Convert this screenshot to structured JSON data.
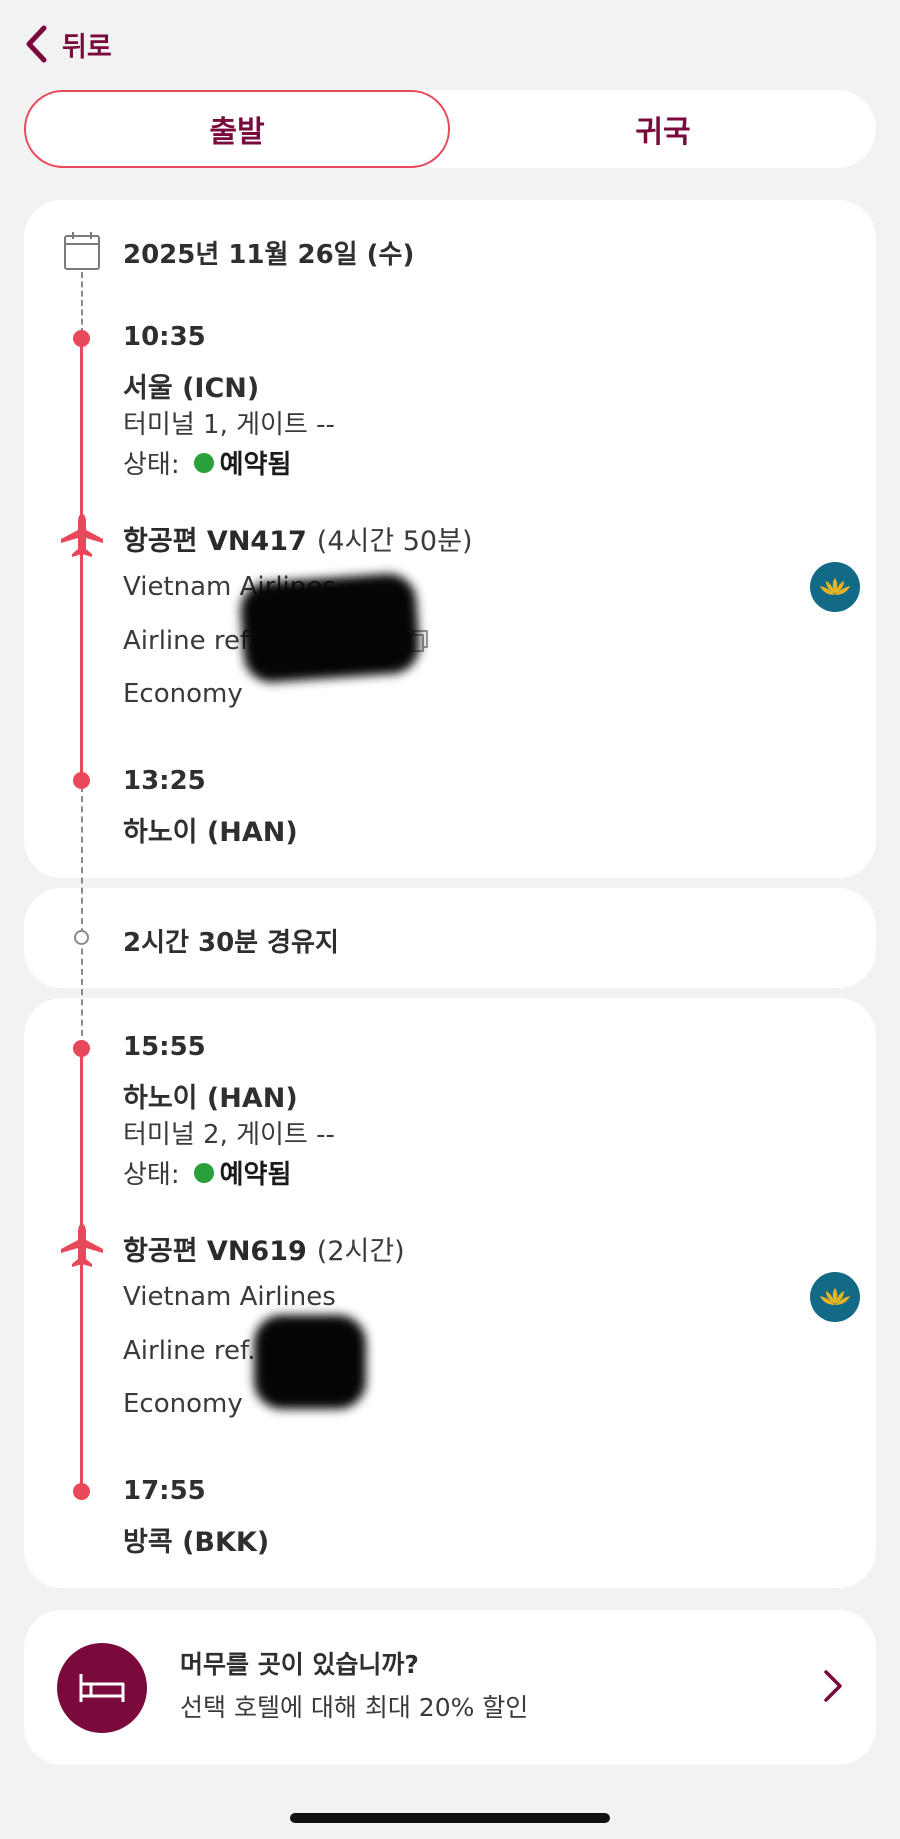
{
  "nav": {
    "back_label": "뒤로"
  },
  "tabs": {
    "departure": "출발",
    "return": "귀국"
  },
  "segment1": {
    "date": "2025년 11월 26일 (수)",
    "dep_time": "10:35",
    "dep_city": "서울 (ICN)",
    "dep_terminal": "터미널 1,  게이트 --",
    "status_label": "상태:",
    "status_value": "예약됨",
    "flight_label": "항공편 VN417",
    "flight_duration": "(4시간 50분)",
    "airline": "Vietnam Airlines",
    "airline_ref": "Airline ref. 80",
    "cabin": "Economy",
    "arr_time": "13:25",
    "arr_city": "하노이 (HAN)"
  },
  "layover": {
    "text": "2시간 30분 경유지"
  },
  "segment2": {
    "dep_time": "15:55",
    "dep_city": "하노이 (HAN)",
    "dep_terminal": "터미널 2,  게이트 --",
    "status_label": "상태:",
    "status_value": "예약됨",
    "flight_label": "항공편 VN619",
    "flight_duration": "(2시간)",
    "airline": "Vietnam Airlines",
    "airline_ref": "Airline ref.      BIR",
    "cabin": "Economy",
    "arr_time": "17:55",
    "arr_city": "방콕 (BKK)"
  },
  "hotel": {
    "title": "머무를 곳이 있습니까?",
    "subtitle": "선택 호텔에 대해 최대 20% 할인"
  },
  "colors": {
    "accent_maroon": "#7a0a3c",
    "timeline_red": "#e8495a",
    "status_green": "#2aa03a",
    "airline_logo_bg": "#126a86"
  },
  "icons": {
    "back": "chevron-left-icon",
    "calendar": "calendar-icon",
    "plane": "plane-icon",
    "copy": "copy-icon",
    "airline_logo": "lotus-icon",
    "bed": "bed-icon",
    "arrow": "chevron-right-icon"
  }
}
